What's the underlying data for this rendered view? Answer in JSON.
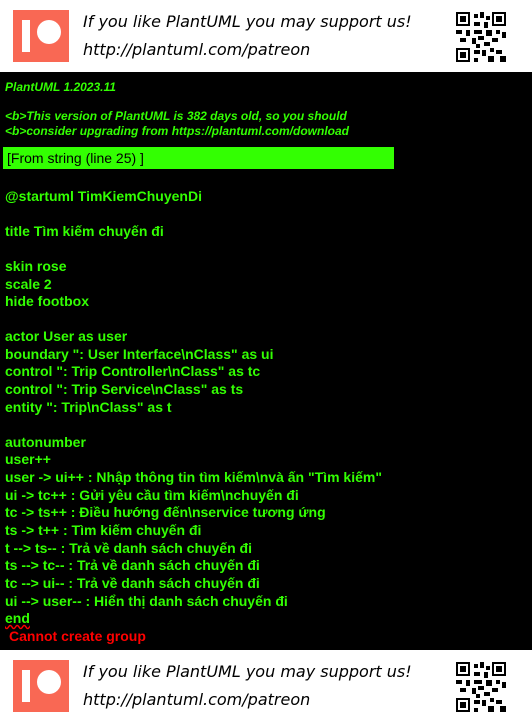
{
  "banner": {
    "line1": "If you like PlantUML you may support us!",
    "line2": "http://plantuml.com/patreon",
    "logo": "patreon-logo",
    "qr": "qr-code"
  },
  "header": {
    "version": "PlantUML 1.2023.11",
    "warning_line1": "<b>This version of PlantUML is 382 days old, so you should",
    "warning_line2": "<b>consider upgrading from https://plantuml.com/download"
  },
  "source_ref": "[From string (line 25) ]",
  "code_lines": [
    "@startuml TimKiemChuyenDi",
    "",
    "title Tìm kiếm chuyến đi",
    "",
    "skin rose",
    "scale 2",
    "hide footbox",
    "",
    "actor User as user",
    "boundary \": User Interface\\nClass\" as ui",
    "control \": Trip Controller\\nClass\" as tc",
    "control \": Trip Service\\nClass\" as ts",
    "entity \": Trip\\nClass\" as t",
    "",
    "autonumber",
    "user++",
    "user -> ui++ : Nhập thông tin tìm kiếm\\nvà ấn \"Tìm kiếm\"",
    "ui -> tc++ : Gửi yêu cầu tìm kiếm\\nchuyến đi",
    "tc -> ts++ : Điều hướng đến\\nservice tương ứng",
    "ts -> t++ : Tìm kiếm chuyến đi",
    "t --> ts-- : Trả về danh sách chuyến đi",
    "ts --> tc-- : Trả về danh sách chuyến đi",
    "tc --> ui-- : Trả về danh sách chuyến đi",
    "ui --> user-- : Hiển thị danh sách chuyến đi",
    "end"
  ],
  "error": "Cannot create group",
  "colors": {
    "text_green": "#33ff02",
    "error_red": "#ff0000",
    "patreon": "#f96854",
    "background": "#000000"
  }
}
